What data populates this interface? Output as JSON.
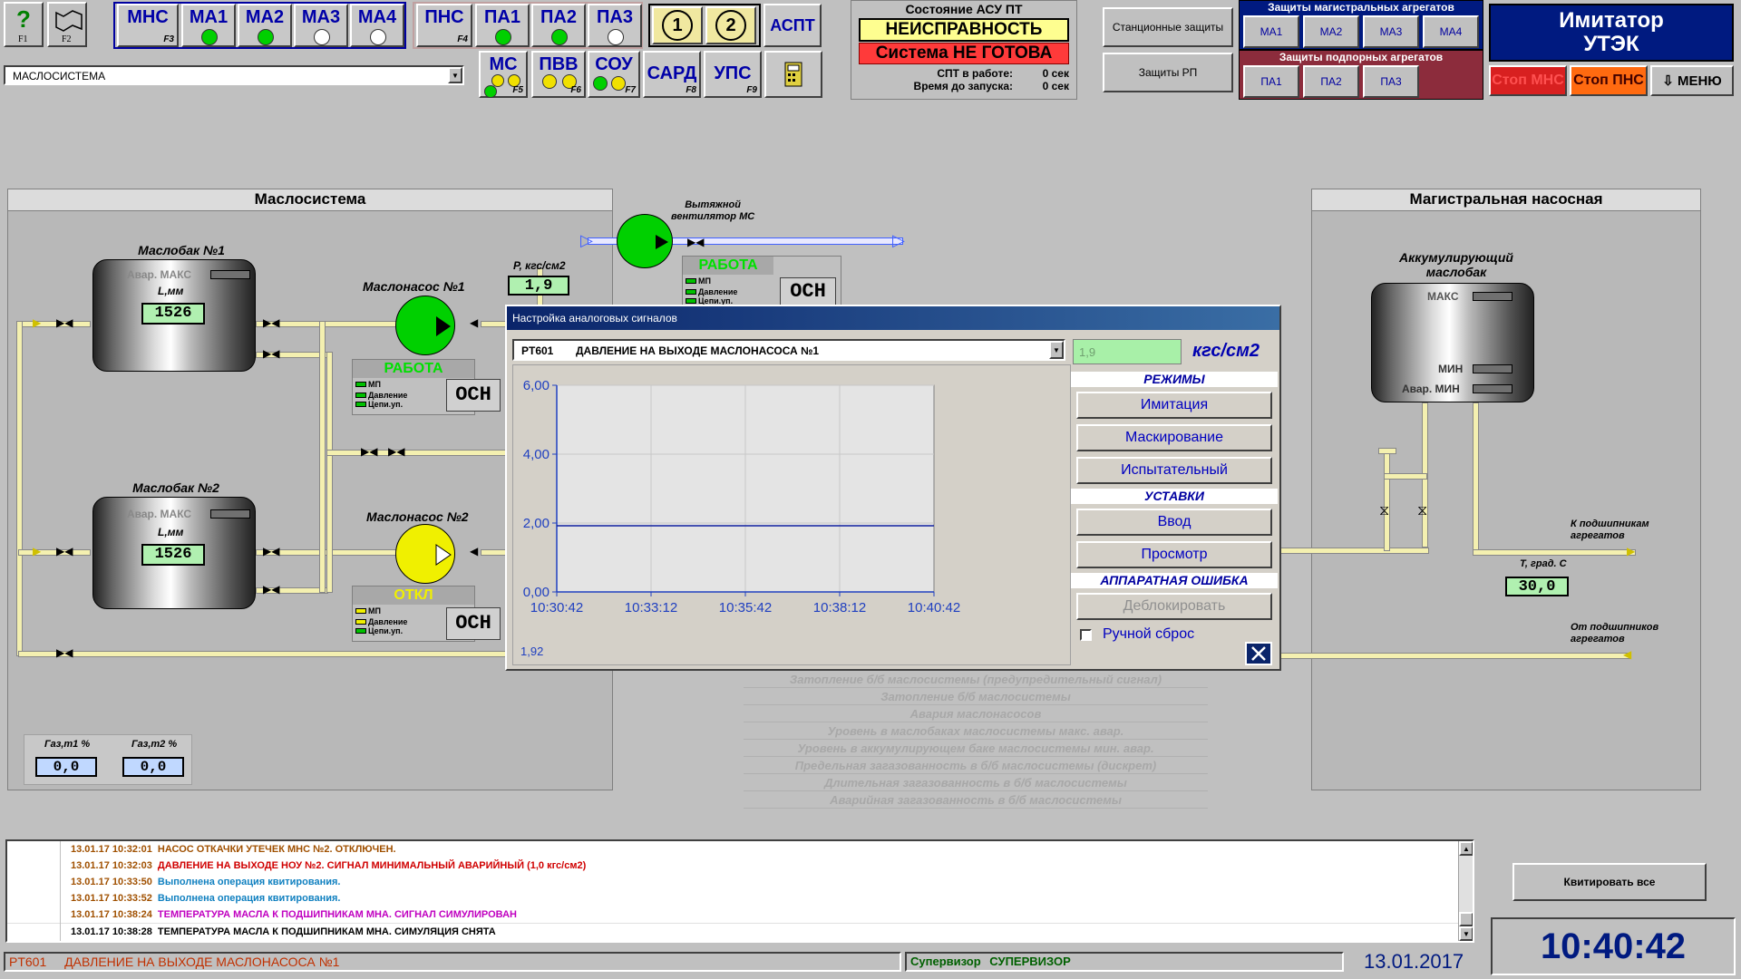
{
  "toolbar": {
    "f1": "F1",
    "f2": "F2",
    "mns": "МНС",
    "mns_key": "F3",
    "ma": [
      "МА1",
      "МА2",
      "МА3",
      "МА4"
    ],
    "pns": "ПНС",
    "pns_key": "F4",
    "pa": [
      "ПА1",
      "ПА2",
      "ПА3"
    ],
    "ms": "МС",
    "ms_key": "F5",
    "pvv": "ПВВ",
    "pvv_key": "F6",
    "sou": "СОУ",
    "sou_key": "F7",
    "sard": "САРД",
    "sard_key": "F8",
    "ups": "УПС",
    "ups_key": "F9",
    "circle1": "1",
    "circle2": "2",
    "aspt": "АСПТ",
    "screen_select": "МАСЛОСИСТЕМА",
    "station_protect": "Станционные защиты",
    "rp_protect": "Защиты РП"
  },
  "asu": {
    "title": "Состояние АСУ ПТ",
    "state": "НЕИСПРАВНОСТЬ",
    "ready": "Система НЕ ГОТОВА",
    "spt_label": "СПТ в работе:",
    "spt_value": "0 сек",
    "start_label": "Время до запуска:",
    "start_value": "0 сек"
  },
  "protections": {
    "main_title": "Защиты магистральных агрегатов",
    "main_items": [
      "МА1",
      "МА2",
      "МА3",
      "МА4"
    ],
    "booster_title": "Защиты подпорных агрегатов",
    "booster_items": [
      "ПА1",
      "ПА2",
      "ПА3"
    ]
  },
  "imitator": {
    "title1": "Имитатор",
    "title2": "УТЭК",
    "stop_mns": "Стоп МНС",
    "stop_pns": "Стоп ПНС",
    "menu": "⇩ МЕНЮ"
  },
  "oil_system": {
    "title": "Маслосистема",
    "tank1": {
      "name": "Маслобак №1",
      "avar_max": "Авар. МАКС",
      "level_label": "L,мм",
      "level": "1526"
    },
    "tank2": {
      "name": "Маслобак №2",
      "avar_max": "Авар. МАКС",
      "level_label": "L,мм",
      "level": "1526"
    },
    "pump1": {
      "name": "Маслонасос №1",
      "status": "РАБОТА",
      "mp": "МП",
      "pressure": "Давление",
      "circuits": "Цепи.уп.",
      "mode": "ОСН"
    },
    "pump2": {
      "name": "Маслонасос №2",
      "status": "ОТКЛ",
      "mp": "МП",
      "pressure": "Давление",
      "circuits": "Цепи.уп.",
      "mode": "ОСН"
    },
    "pressure_label": "P, кгс/см2",
    "pressure_value": "1,9",
    "fan_label1": "Вытяжной",
    "fan_label2": "вентилятор МС",
    "fan": {
      "status": "РАБОТА",
      "mp": "МП",
      "pressure": "Давление",
      "circuits": "Цепи.уп.",
      "mode": "ОСН"
    },
    "gas1_label": "Газ,т1 %",
    "gas1": "0,0",
    "gas2_label": "Газ,т2 %",
    "gas2": "0,0"
  },
  "main_pump": {
    "title": "Магистральная насосная",
    "tank_label1": "Аккумулирующий",
    "tank_label2": "маслобак",
    "max": "МАКС",
    "min": "МИН",
    "avar_min": "Авар. МИН",
    "to_bearings1": "К подшипникам",
    "to_bearings2": "агрегатов",
    "from_bearings1": "От подшипников",
    "from_bearings2": "агрегатов",
    "temp_label": "T, град. С",
    "temp": "30,0"
  },
  "alarms": [
    "Затопление б/б маслосистемы (предупредительный сигнал)",
    "Затопление б/б маслосистемы",
    "Авария маслонасосов",
    "Уровень в маслобаках маслосистемы макс. авар.",
    "Уровень в аккумулирующем баке маслосистемы мин. авар.",
    "Предельная загазованность в б/б маслосистемы (дискрет)",
    "Длительная загазованность в б/б маслосистемы",
    "Аварийная загазованность в б/б маслосистемы"
  ],
  "dialog": {
    "title": "Настройка аналоговых сигналов",
    "signal_code": "PT601",
    "signal_name": "ДАВЛЕНИЕ НА ВЫХОДЕ МАСЛОНАСОСА №1",
    "value": "1,9",
    "unit": "кгс/см2",
    "modes_title": "РЕЖИМЫ",
    "btn_imitation": "Имитация",
    "btn_masking": "Маскирование",
    "btn_test": "Испытательный",
    "setpoints_title": "УСТАВКИ",
    "btn_input": "Ввод",
    "btn_view": "Просмотр",
    "hw_error_title": "АППАРАТНАЯ ОШИБКА",
    "btn_unblock": "Деблокировать",
    "manual_reset": "Ручной сброс",
    "cursor_value": "1,92"
  },
  "chart_data": {
    "type": "line",
    "x": [
      "10:30:42",
      "10:33:12",
      "10:35:42",
      "10:38:12",
      "10:40:42"
    ],
    "yticks": [
      "0,00",
      "2,00",
      "4,00",
      "6,00"
    ],
    "ylim": [
      0,
      6
    ],
    "series": [
      {
        "values": [
          1.92,
          1.92,
          1.92,
          1.92,
          1.92
        ]
      }
    ],
    "grid": true,
    "line_color": "#1020a0"
  },
  "log": [
    {
      "time": "13.01.17 10:32:01",
      "text": "НАСОС ОТКАЧКИ УТЕЧЕК МНС №2. ОТКЛЮЧЕН.",
      "color": "#a05000"
    },
    {
      "time": "13.01.17 10:32:03",
      "text": "ДАВЛЕНИЕ НА ВЫХОДЕ НОУ №2. СИГНАЛ МИНИМАЛЬНЫЙ АВАРИЙНЫЙ (1,0 кгс/см2)",
      "color": "#d00000"
    },
    {
      "time": "13.01.17 10:33:50",
      "text": "Выполнена операция квитирования.",
      "color": "#1080c0"
    },
    {
      "time": "13.01.17 10:33:52",
      "text": "Выполнена операция квитирования.",
      "color": "#1080c0"
    },
    {
      "time": "13.01.17 10:38:24",
      "text": "ТЕМПЕРАТУРА МАСЛА К ПОДШИПНИКАМ МНА. СИГНАЛ СИМУЛИРОВАН",
      "color": "#c000c0"
    },
    {
      "time": "13.01.17 10:38:28",
      "text": "ТЕМПЕРАТУРА МАСЛА К ПОДШИПНИКАМ МНА. СИМУЛЯЦИЯ СНЯТА",
      "color": "#000000"
    }
  ],
  "ack_all": "Квитировать все",
  "status_bar": {
    "signal_code": "PT601",
    "signal_name": "ДАВЛЕНИЕ НА ВЫХОДЕ МАСЛОНАСОСА №1",
    "role_label": "Супервизор",
    "user": "СУПЕРВИЗОР",
    "date": "13.01.2017",
    "time": "10:40:42"
  }
}
